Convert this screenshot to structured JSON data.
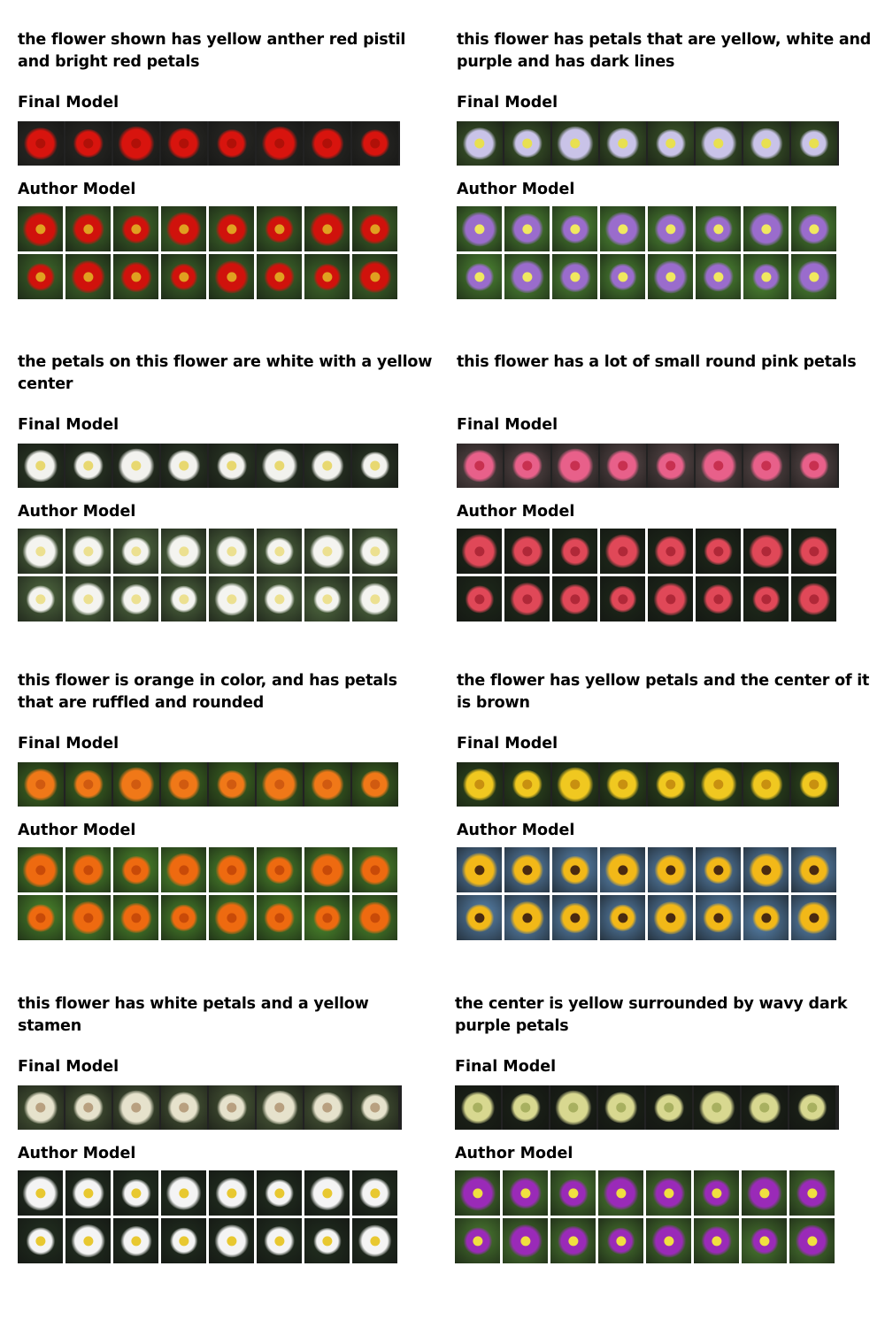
{
  "labels": {
    "final": "Final Model",
    "author": "Author Model"
  },
  "examples": [
    {
      "caption": "the flower shown has yellow anther red pistil and bright red petals",
      "palette": {
        "bg": "#2a2a26",
        "petal": "#d8140e",
        "center": "#b01008"
      },
      "author_palette": {
        "bg": "#3f6a2a",
        "petal": "#d0120c",
        "center": "#e0a020"
      }
    },
    {
      "caption": "this flower has petals that are yellow, white and purple and has dark lines",
      "palette": {
        "bg": "#3d5a2a",
        "petal": "#c9c3e8",
        "center": "#e8e050"
      },
      "author_palette": {
        "bg": "#4e8a33",
        "petal": "#9a6ccc",
        "center": "#f0e860"
      }
    },
    {
      "caption": "the petals on this flower are white with a yellow center",
      "palette": {
        "bg": "#2c3a26",
        "petal": "#f2f2ee",
        "center": "#e8d870"
      },
      "author_palette": {
        "bg": "#506a40",
        "petal": "#f4f4f0",
        "center": "#ece090"
      }
    },
    {
      "caption": "this flower has a lot of small round pink petals",
      "palette": {
        "bg": "#5a4a4a",
        "petal": "#e8608a",
        "center": "#c83050"
      },
      "author_palette": {
        "bg": "#1e2a1a",
        "petal": "#e04858",
        "center": "#b02838"
      }
    },
    {
      "caption": "this flower is orange in color, and has petals that are ruffled and rounded",
      "palette": {
        "bg": "#3e6a22",
        "petal": "#f07818",
        "center": "#d05a10"
      },
      "author_palette": {
        "bg": "#4c8a2c",
        "petal": "#ee6a10",
        "center": "#c84a08"
      }
    },
    {
      "caption": "the flower has yellow petals and the center of it is brown",
      "palette": {
        "bg": "#2e4a1e",
        "petal": "#f0c820",
        "center": "#c89010"
      },
      "author_palette": {
        "bg": "#5a86b0",
        "petal": "#f2b818",
        "center": "#4a2a10"
      }
    },
    {
      "caption": "this flower has white petals and a yellow stamen",
      "palette": {
        "bg": "#4a5a38",
        "petal": "#e6e2cc",
        "center": "#b8a080"
      },
      "author_palette": {
        "bg": "#223020",
        "petal": "#f4f4f4",
        "center": "#e8c830"
      }
    },
    {
      "caption": "the center is yellow surrounded by wavy dark purple petals",
      "palette": {
        "bg": "#1c2418",
        "petal": "#d8d890",
        "center": "#a8b060"
      },
      "author_palette": {
        "bg": "#4a7a30",
        "petal": "#9a2ab8",
        "center": "#f0e040"
      }
    }
  ]
}
